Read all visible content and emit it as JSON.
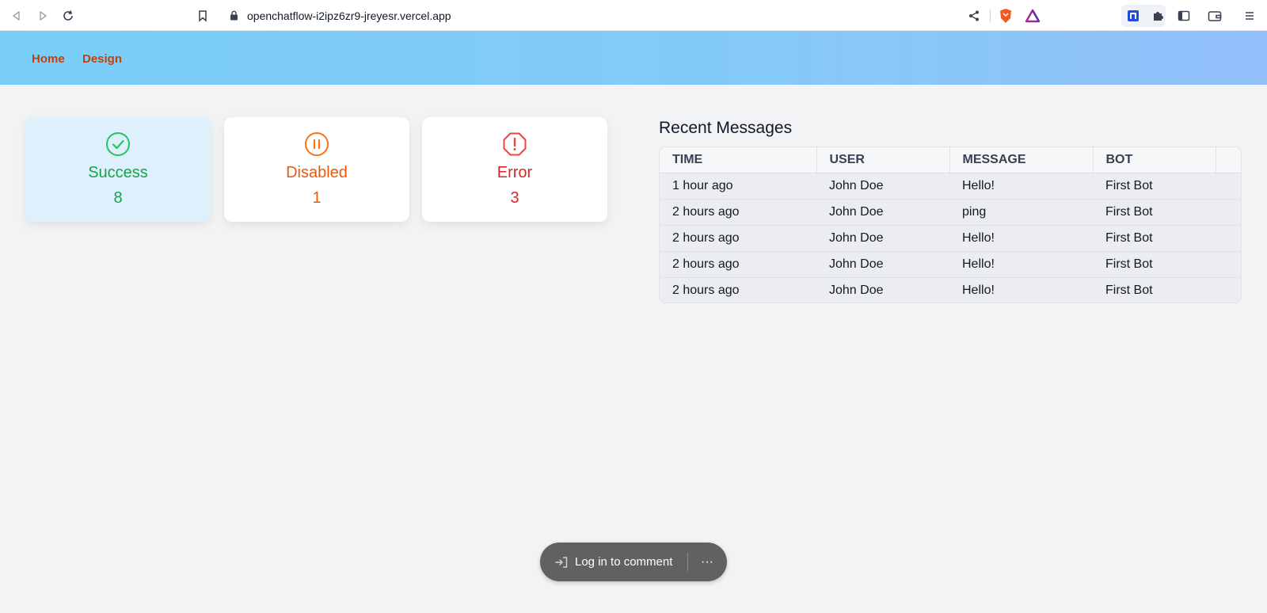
{
  "browser": {
    "url": "openchatflow-i2ipz6zr9-jreyesr.vercel.app"
  },
  "nav": {
    "links": [
      "Home",
      "Design"
    ],
    "link_color": "#c2410c"
  },
  "status_cards": [
    {
      "label": "Success",
      "value": "8",
      "icon": "check-circle-icon",
      "color": "#16a34a"
    },
    {
      "label": "Disabled",
      "value": "1",
      "icon": "pause-circle-icon",
      "color": "#ea580c"
    },
    {
      "label": "Error",
      "value": "3",
      "icon": "alert-octagon-icon",
      "color": "#dc2626"
    }
  ],
  "messages": {
    "title": "Recent Messages",
    "columns": [
      "TIME",
      "USER",
      "MESSAGE",
      "BOT"
    ],
    "rows": [
      [
        "1 hour ago",
        "John Doe",
        "Hello!",
        "First Bot"
      ],
      [
        "2 hours ago",
        "John Doe",
        "ping",
        "First Bot"
      ],
      [
        "2 hours ago",
        "John Doe",
        "Hello!",
        "First Bot"
      ],
      [
        "2 hours ago",
        "John Doe",
        "Hello!",
        "First Bot"
      ],
      [
        "2 hours ago",
        "John Doe",
        "Hello!",
        "First Bot"
      ]
    ]
  },
  "comment_bar": {
    "login_label": "Log in to comment",
    "more_label": "···"
  }
}
